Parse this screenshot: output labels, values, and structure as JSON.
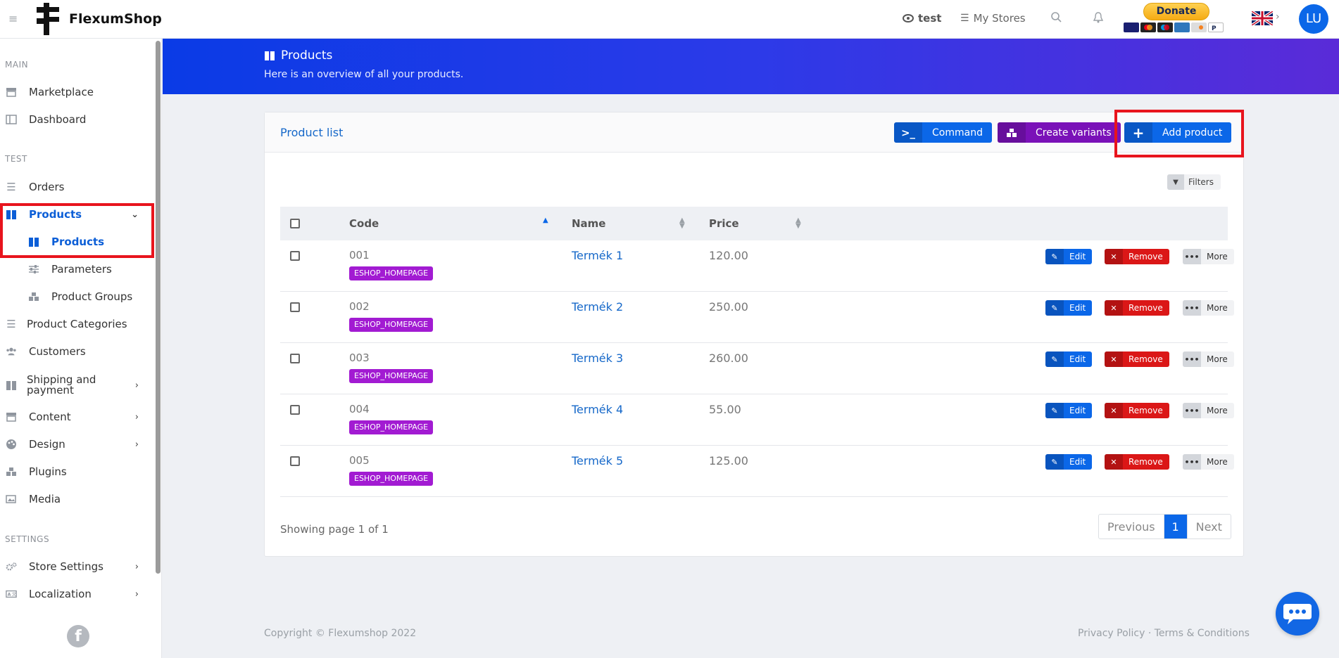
{
  "header": {
    "brand": "FlexumShop",
    "store_view": "test",
    "my_stores": "My Stores",
    "donate_label": "Donate",
    "donate_cards": [
      "VISA",
      "MC",
      "MC",
      "AMEX",
      "DISC",
      "PP"
    ],
    "avatar_initials": "LU",
    "language_flag": "uk-flag-icon"
  },
  "sidebar": {
    "section_main": "MAIN",
    "marketplace": "Marketplace",
    "dashboard": "Dashboard",
    "section_test": "TEST",
    "orders": "Orders",
    "products": "Products",
    "products_sub": "Products",
    "parameters": "Parameters",
    "product_groups": "Product Groups",
    "product_categories": "Product Categories",
    "customers": "Customers",
    "shipping_line1": "Shipping and",
    "shipping_line2": "payment",
    "content": "Content",
    "design": "Design",
    "plugins": "Plugins",
    "media": "Media",
    "section_settings": "SETTINGS",
    "store_settings": "Store Settings",
    "localization": "Localization"
  },
  "banner": {
    "title": "Products",
    "subtitle": "Here is an overview of all your products."
  },
  "panel": {
    "title": "Product list",
    "command_label": "Command",
    "create_variants_label": "Create variants",
    "add_product_label": "Add product",
    "filters_label": "Filters"
  },
  "table": {
    "headers": {
      "code": "Code",
      "name": "Name",
      "price": "Price"
    },
    "rows": [
      {
        "code": "001",
        "badge": "ESHOP_HOMEPAGE",
        "name": "Termék 1",
        "price": "120.00"
      },
      {
        "code": "002",
        "badge": "ESHOP_HOMEPAGE",
        "name": "Termék 2",
        "price": "250.00"
      },
      {
        "code": "003",
        "badge": "ESHOP_HOMEPAGE",
        "name": "Termék 3",
        "price": "260.00"
      },
      {
        "code": "004",
        "badge": "ESHOP_HOMEPAGE",
        "name": "Termék 4",
        "price": "55.00"
      },
      {
        "code": "005",
        "badge": "ESHOP_HOMEPAGE",
        "name": "Termék 5",
        "price": "125.00"
      }
    ],
    "actions": {
      "edit": "Edit",
      "remove": "Remove",
      "more": "More"
    }
  },
  "pagination": {
    "showing": "Showing page 1 of 1",
    "previous": "Previous",
    "current": "1",
    "next": "Next"
  },
  "footer": {
    "copyright": "Copyright © Flexumshop 2022",
    "links": "Privacy Policy · Terms & Conditions"
  },
  "colors": {
    "accent": "#0b67e8",
    "danger": "#db1717",
    "variants": "#7a11b8",
    "badge": "#a21bd2",
    "highlight": "#e8141d"
  }
}
